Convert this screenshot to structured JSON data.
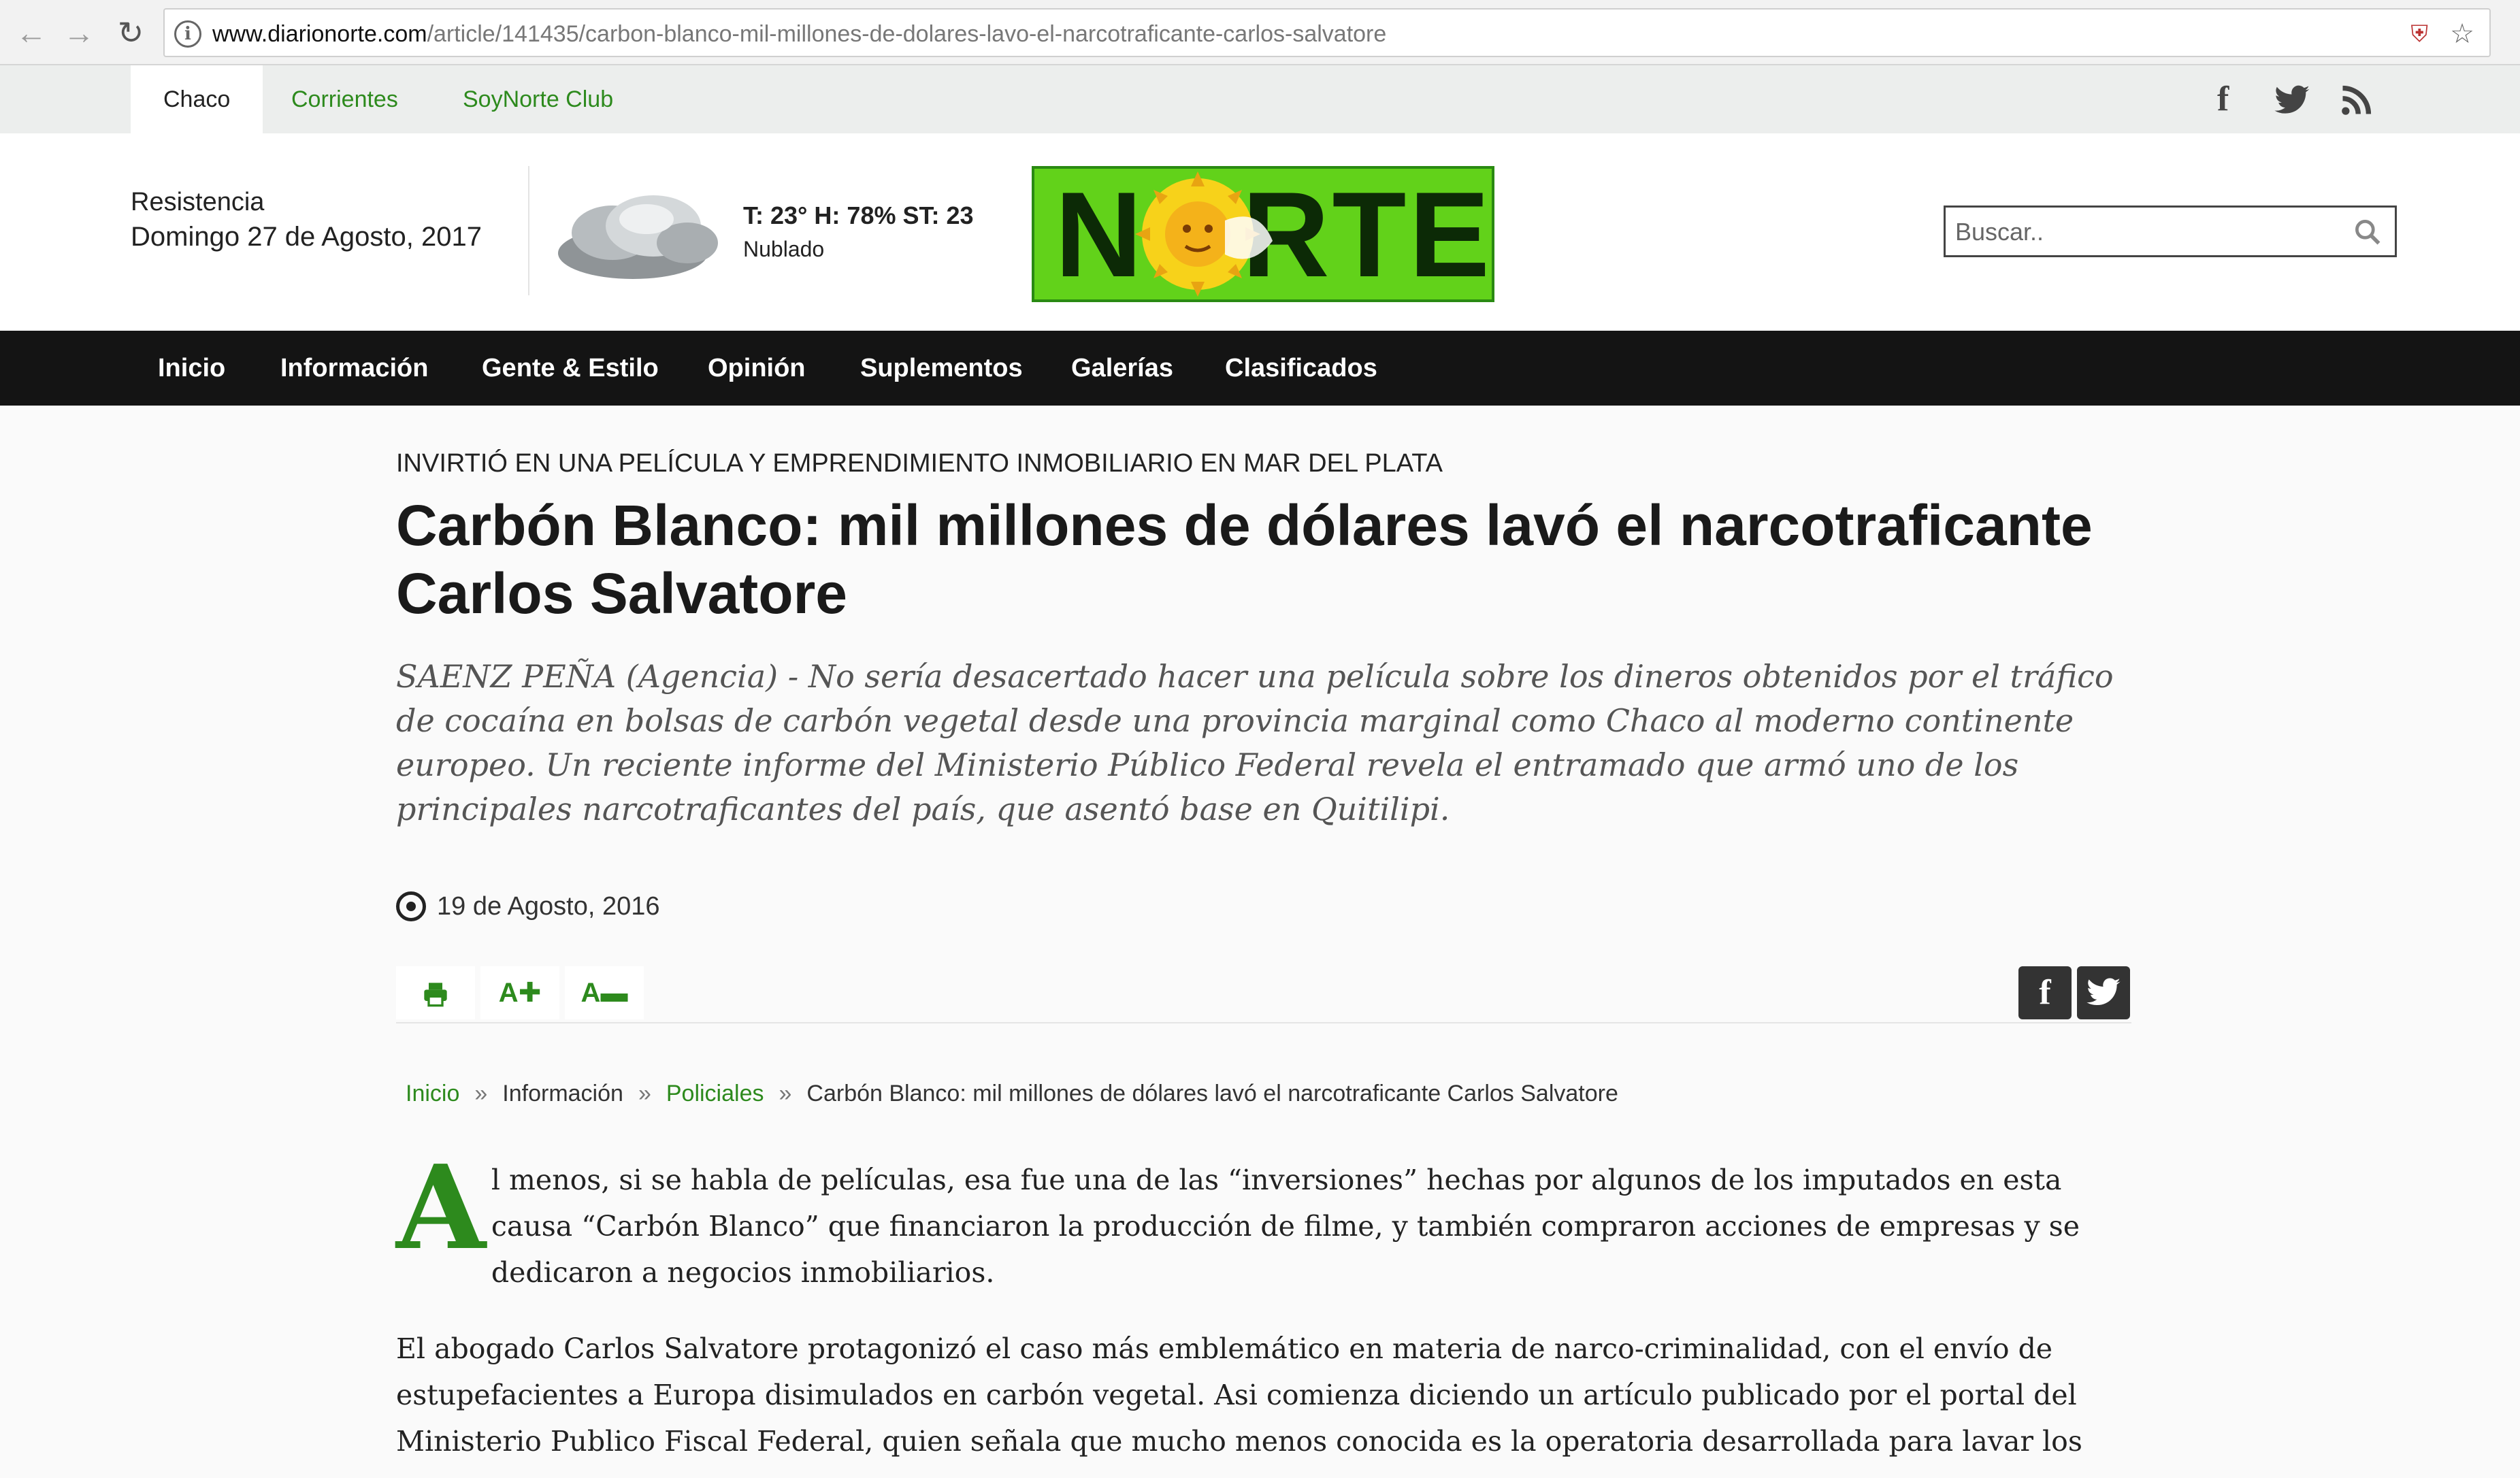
{
  "browser": {
    "url_domain": "www.diarionorte.com",
    "url_path": "/article/141435/carbon-blanco-mil-millones-de-dolares-lavo-el-narcotraficante-carlos-salvatore"
  },
  "regions": {
    "tabs": [
      "Chaco",
      "Corrientes",
      "SoyNorte Club"
    ],
    "active": "Chaco"
  },
  "header": {
    "city": "Resistencia",
    "date": "Domingo  27 de Agosto, 2017",
    "weather": "T: 23° H: 78% ST: 23",
    "condition": "Nublado",
    "search_placeholder": "Buscar..",
    "logo_text": "NORTE"
  },
  "nav": {
    "items": [
      "Inicio",
      "Información",
      "Gente & Estilo",
      "Opinión",
      "Suplementos",
      "Galerías",
      "Clasificados"
    ]
  },
  "article": {
    "kicker": "INVIRTIÓ EN UNA PELÍCULA Y EMPRENDIMIENTO INMOBILIARIO EN MAR DEL PLATA",
    "title": "Carbón Blanco: mil millones de dólares lavó el narcotraficante Carlos Salvatore",
    "lead": "SAENZ PEÑA (Agencia) - No sería desacertado hacer una película sobre los dineros obtenidos por el tráfico de cocaína en bolsas de carbón vegetal desde una provincia marginal como Chaco al moderno continente europeo. Un reciente informe del Ministerio Público Federal revela el entramado que armó uno de los principales narcotraficantes del país, que asentó base en Quitilipi.",
    "date": "19 de Agosto, 2016",
    "tools": {
      "increase": "A",
      "decrease": "A"
    },
    "breadcrumb": {
      "home": "Inicio",
      "section": "Información",
      "category": "Policiales",
      "current": "Carbón Blanco: mil millones de dólares lavó el narcotraficante Carlos Salvatore",
      "separator": "»"
    },
    "dropcap": "A",
    "para1_rest": "l menos, si se habla de películas, esa fue una de las “inversiones” hechas por algunos de los imputados en esta causa “Carbón Blanco” que financiaron la producción de filme, y también compraron acciones de empresas y se dedicaron a negocios inmobiliarios.",
    "para2": "El abogado Carlos Salvatore protagonizó el caso más emblemático en materia de narco-criminalidad, con el envío de estupefacientes a Europa disimulados en carbón vegetal. Asi comienza diciendo un artículo publicado por el portal del Ministerio Publico Fiscal Federal, quien señala que mucho menos conocida es la operatoria desarrollada para lavar los"
  },
  "colors": {
    "accent_green": "#2d8a1d",
    "logo_green": "#62d21a",
    "nav_bg": "#141414"
  },
  "icons": [
    "info-icon",
    "back-icon",
    "forward-icon",
    "reload-icon",
    "shield-icon",
    "star-icon",
    "facebook-icon",
    "twitter-icon",
    "rss-icon",
    "cloud-icon",
    "search-icon",
    "print-icon",
    "clock-icon"
  ]
}
